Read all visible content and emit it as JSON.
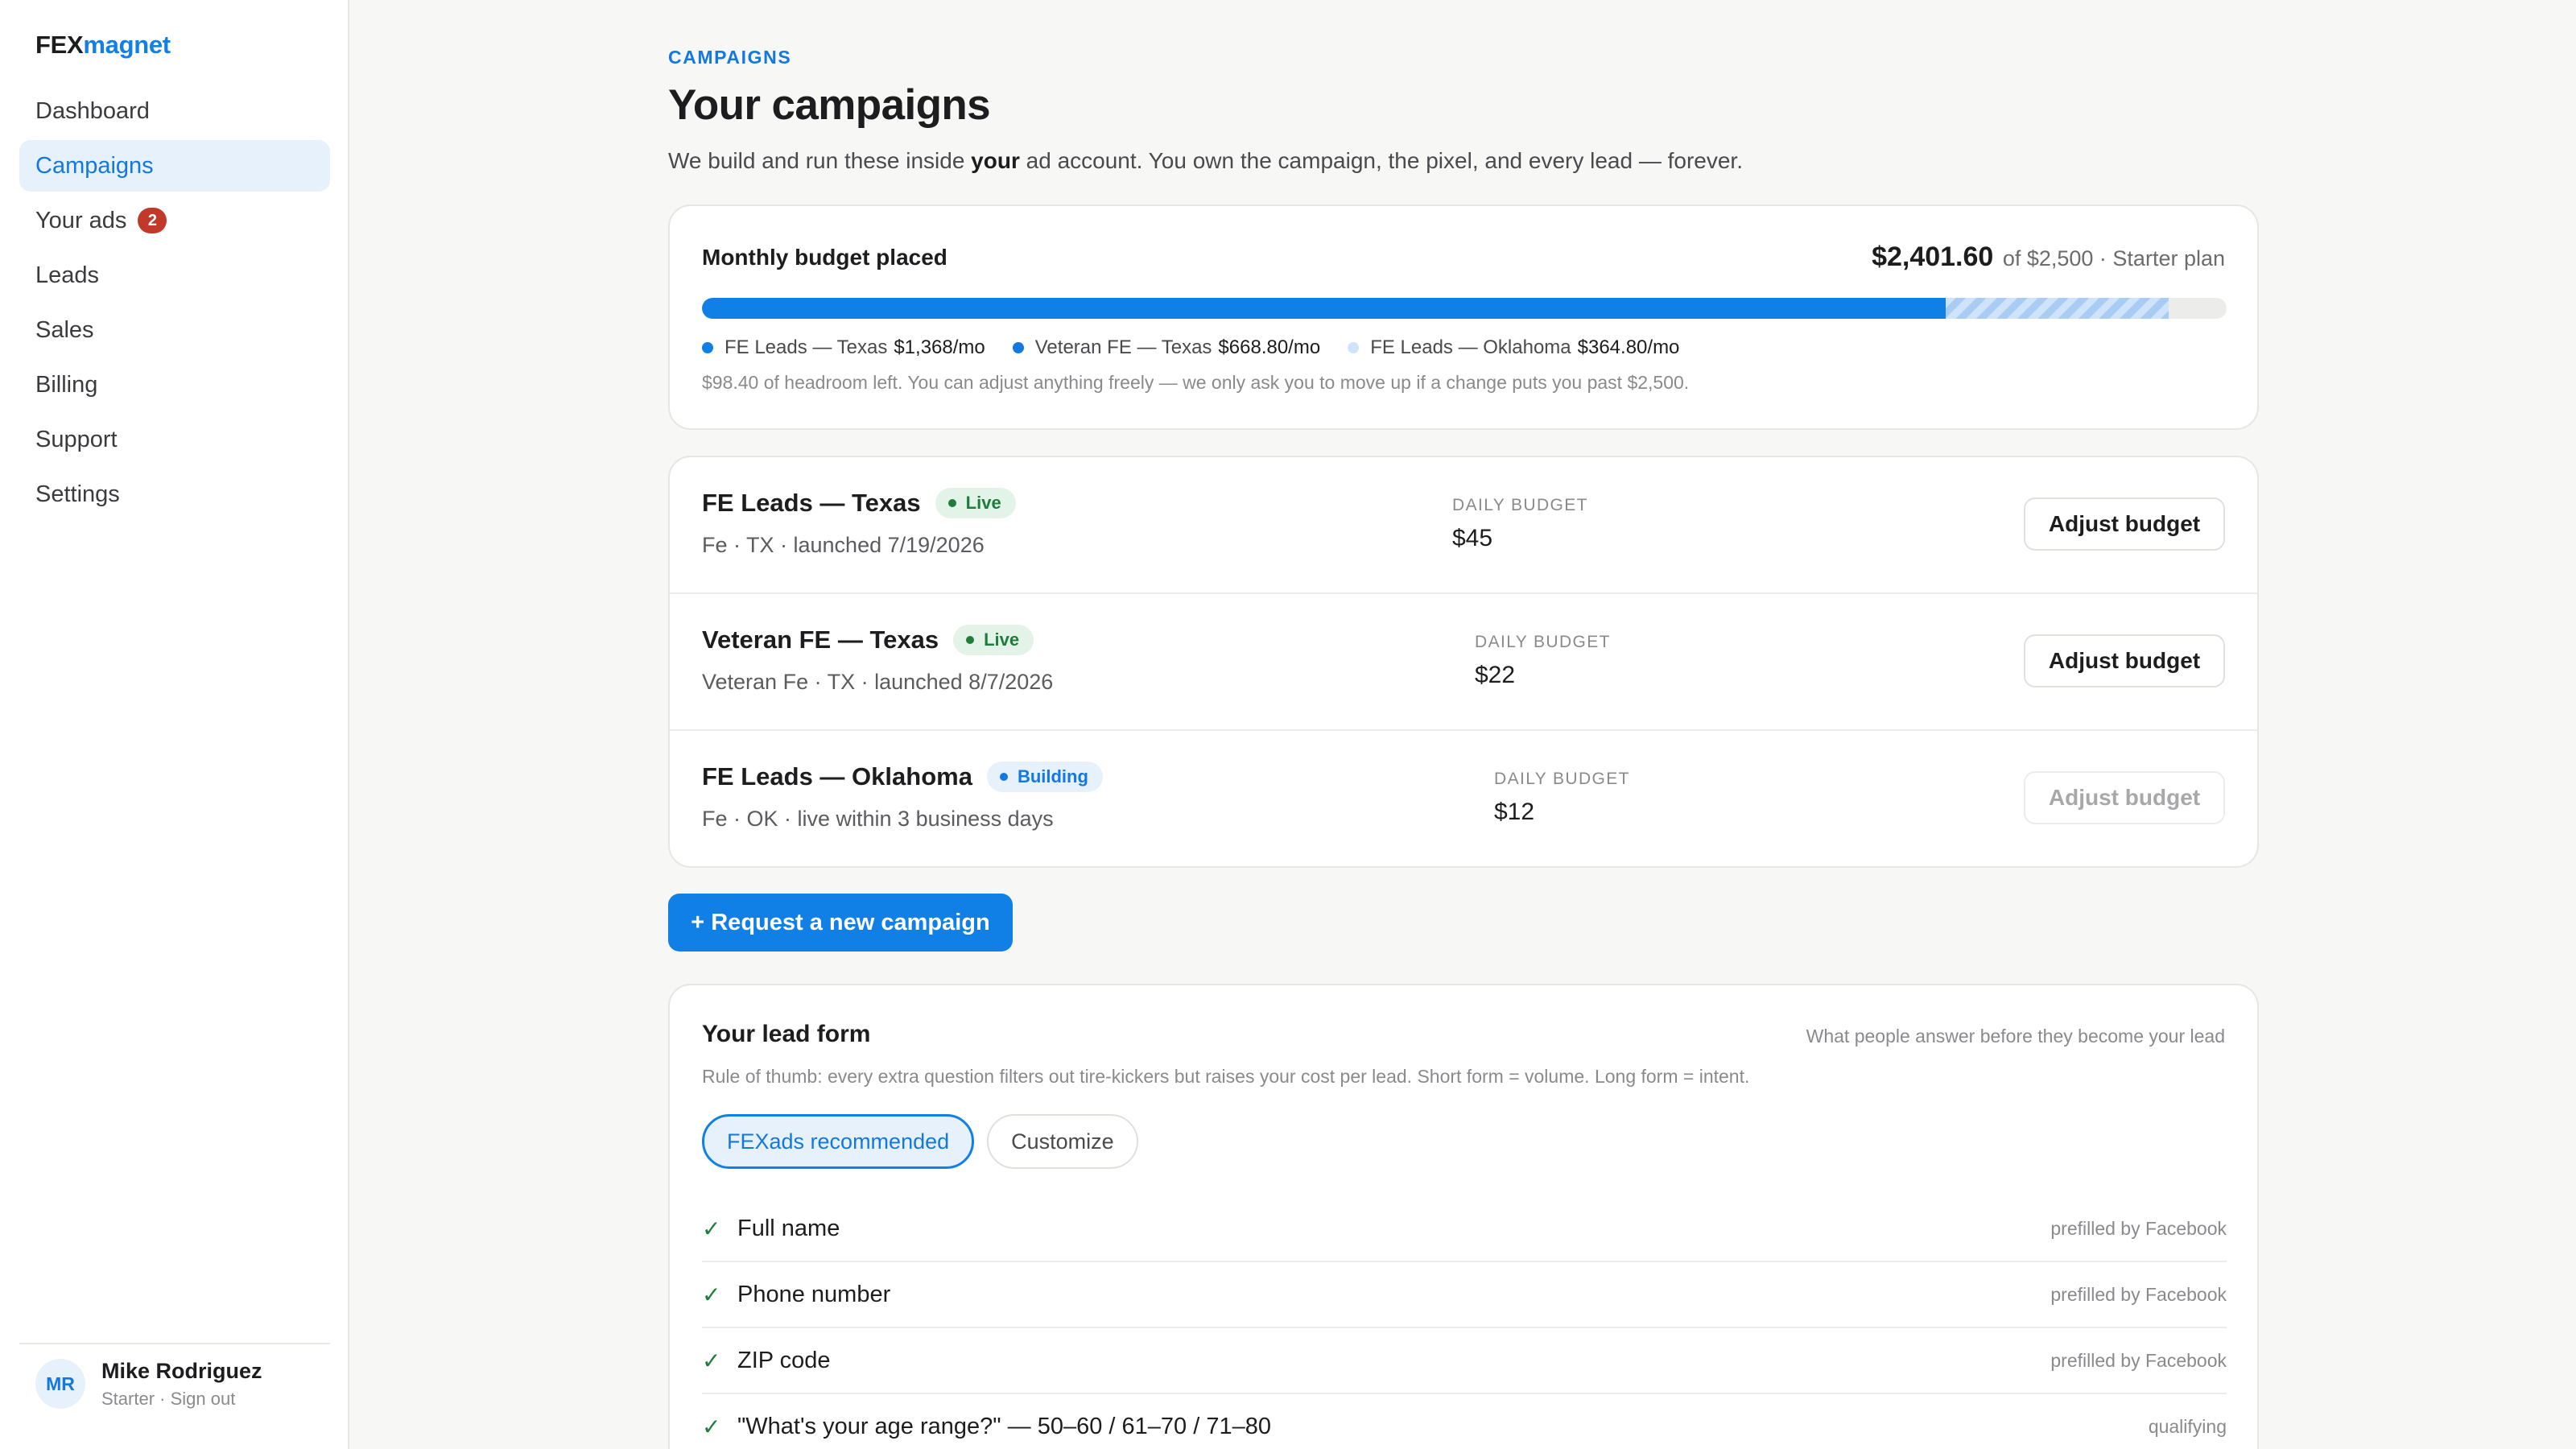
{
  "brand": {
    "part1": "FEX",
    "part2": "magnet",
    "accent": "#1180e6"
  },
  "nav": [
    {
      "label": "Dashboard"
    },
    {
      "label": "Campaigns",
      "active": true
    },
    {
      "label": "Your ads",
      "badge": "2"
    },
    {
      "label": "Leads"
    },
    {
      "label": "Sales"
    },
    {
      "label": "Billing"
    },
    {
      "label": "Support"
    },
    {
      "label": "Settings"
    }
  ],
  "user": {
    "initials": "MR",
    "name": "Mike Rodriguez",
    "plan": "Starter",
    "separator": " · ",
    "signout": "Sign out"
  },
  "page": {
    "eyebrow": "CAMPAIGNS",
    "title": "Your campaigns",
    "desc_before": "We build and run these inside ",
    "desc_bold": "your",
    "desc_after": " ad account. You own the campaign, the pixel, and every lead — forever."
  },
  "budget": {
    "label": "Monthly budget placed",
    "placed": "$2,401.60",
    "of_text": " of $2,500 · Starter plan",
    "placed_fraction": 0.8159,
    "hatched_fraction": 0.146,
    "legend": [
      {
        "name": "FE Leads — Texas",
        "amount": "$1,368/mo",
        "color": "#1180e6"
      },
      {
        "name": "Veteran FE — Texas",
        "amount": "$668.80/mo",
        "color": "#1378e0"
      },
      {
        "name": "FE Leads — Oklahoma",
        "amount": "$364.80/mo",
        "color": "#cfe3fb"
      }
    ],
    "headroom": "$98.40 of headroom left. You can adjust anything freely — we only ask you to move up if a change puts you past $2,500."
  },
  "campaigns": [
    {
      "name": "FE Leads — Texas",
      "status": "Live",
      "status_type": "live",
      "meta": "Fe · TX · launched 7/19/2026",
      "daily_label": "DAILY BUDGET",
      "daily": "$45",
      "button": "Adjust budget",
      "disabled": false
    },
    {
      "name": "Veteran FE — Texas",
      "status": "Live",
      "status_type": "live",
      "meta": "Veteran Fe · TX · launched 8/7/2026",
      "daily_label": "DAILY BUDGET",
      "daily": "$22",
      "button": "Adjust budget",
      "disabled": false
    },
    {
      "name": "FE Leads — Oklahoma",
      "status": "Building",
      "status_type": "building",
      "meta": "Fe · OK · live within 3 business days",
      "daily_label": "DAILY BUDGET",
      "daily": "$12",
      "button": "Adjust budget",
      "disabled": true
    }
  ],
  "request_button": "+ Request a new campaign",
  "lead_form": {
    "title": "Your lead form",
    "hint": "What people answer before they become your lead",
    "rule": "Rule of thumb: every extra question filters out tire-kickers but raises your cost per lead. Short form = volume. Long form = intent.",
    "toggle": [
      "FEXads recommended",
      "Customize"
    ],
    "fields": [
      {
        "label": "Full name",
        "note": "prefilled by Facebook"
      },
      {
        "label": "Phone number",
        "note": "prefilled by Facebook"
      },
      {
        "label": "ZIP code",
        "note": "prefilled by Facebook"
      },
      {
        "label": "\"What's your age range?\" — 50–60 / 61–70 / 71–80",
        "note": "qualifying"
      }
    ]
  }
}
